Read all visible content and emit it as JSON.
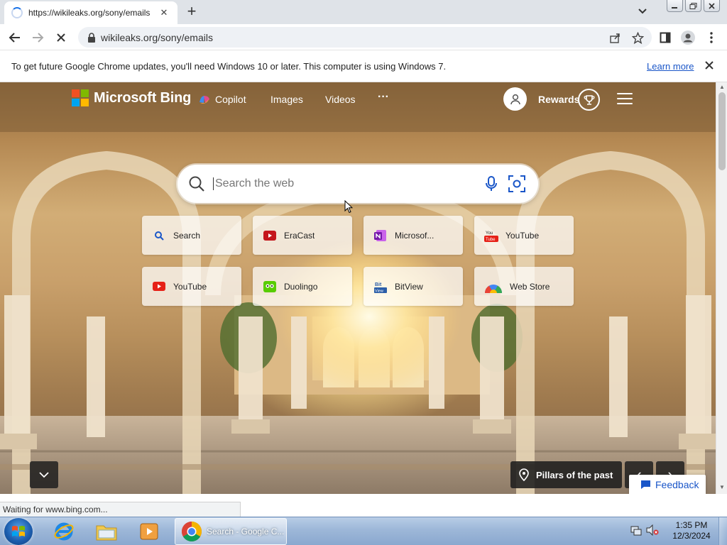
{
  "browser": {
    "tab_title": "https://wikileaks.org/sony/emails",
    "new_tab_symbol": "+",
    "tab_close_symbol": "✕",
    "address": "wikileaks.org/sony/emails"
  },
  "infobar": {
    "message": "To get future Google Chrome updates, you'll need Windows 10 or later. This computer is using Windows 7.",
    "learn_more": "Learn more"
  },
  "bing": {
    "logo_text": "Microsoft Bing",
    "nav": {
      "copilot": "Copilot",
      "images": "Images",
      "videos": "Videos",
      "more": "···"
    },
    "rewards_label": "Rewards",
    "search_placeholder": "Search the web",
    "tiles": [
      {
        "label": "Search",
        "icon": "search-icon",
        "color": "#1a56c8"
      },
      {
        "label": "EraCast",
        "icon": "play-icon",
        "color": "#c4161c"
      },
      {
        "label": "Microsof...",
        "icon": "onenote-icon",
        "color": "#7719aa"
      },
      {
        "label": "YouTube",
        "icon": "youtube-icon",
        "color": "#e62117"
      },
      {
        "label": "YouTube",
        "icon": "youtube-icon",
        "color": "#e62117"
      },
      {
        "label": "Duolingo",
        "icon": "duolingo-icon",
        "color": "#58cc02"
      },
      {
        "label": "BitView",
        "icon": "bitview-icon",
        "color": "#2b5ea8"
      },
      {
        "label": "Web Store",
        "icon": "chrome-webstore-icon",
        "color": "#4285f4"
      }
    ],
    "caption": "Pillars of the past",
    "feedback": "Feedback",
    "prev_symbol": "‹",
    "next_symbol": "›"
  },
  "status_text": "Waiting for www.bing.com...",
  "taskbar": {
    "chrome_label": "Search - Google C...",
    "time": "1:35 PM",
    "date": "12/3/2024"
  }
}
